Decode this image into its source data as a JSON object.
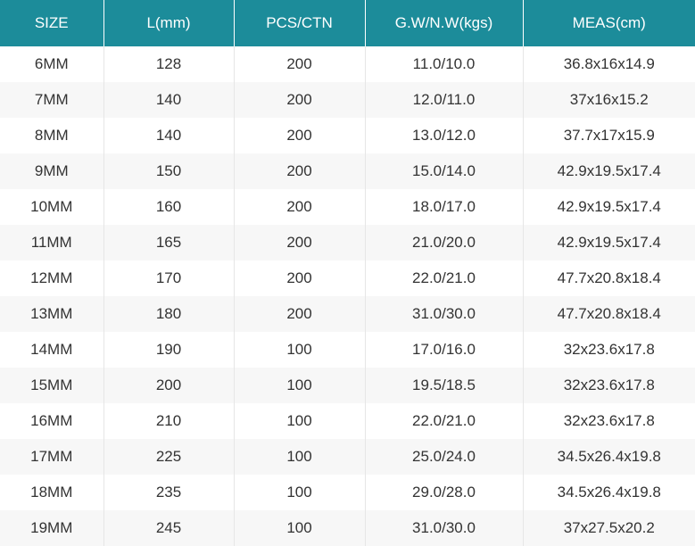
{
  "table": {
    "headers": [
      "SIZE",
      "L(mm)",
      "PCS/CTN",
      "G.W/N.W(kgs)",
      "MEAS(cm)"
    ],
    "rows": [
      [
        "6MM",
        "128",
        "200",
        "11.0/10.0",
        "36.8x16x14.9"
      ],
      [
        "7MM",
        "140",
        "200",
        "12.0/11.0",
        "37x16x15.2"
      ],
      [
        "8MM",
        "140",
        "200",
        "13.0/12.0",
        "37.7x17x15.9"
      ],
      [
        "9MM",
        "150",
        "200",
        "15.0/14.0",
        "42.9x19.5x17.4"
      ],
      [
        "10MM",
        "160",
        "200",
        "18.0/17.0",
        "42.9x19.5x17.4"
      ],
      [
        "11MM",
        "165",
        "200",
        "21.0/20.0",
        "42.9x19.5x17.4"
      ],
      [
        "12MM",
        "170",
        "200",
        "22.0/21.0",
        "47.7x20.8x18.4"
      ],
      [
        "13MM",
        "180",
        "200",
        "31.0/30.0",
        "47.7x20.8x18.4"
      ],
      [
        "14MM",
        "190",
        "100",
        "17.0/16.0",
        "32x23.6x17.8"
      ],
      [
        "15MM",
        "200",
        "100",
        "19.5/18.5",
        "32x23.6x17.8"
      ],
      [
        "16MM",
        "210",
        "100",
        "22.0/21.0",
        "32x23.6x17.8"
      ],
      [
        "17MM",
        "225",
        "100",
        "25.0/24.0",
        "34.5x26.4x19.8"
      ],
      [
        "18MM",
        "235",
        "100",
        "29.0/28.0",
        "34.5x26.4x19.8"
      ],
      [
        "19MM",
        "245",
        "100",
        "31.0/30.0",
        "37x27.5x20.2"
      ]
    ]
  },
  "colors": {
    "header_bg": "#1c8c9a",
    "header_text": "#ffffff",
    "body_text": "#333333",
    "stripe_bg": "#f7f7f7"
  }
}
